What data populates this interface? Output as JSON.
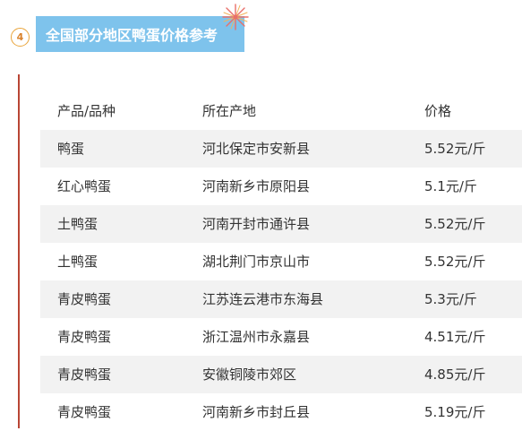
{
  "section": {
    "number": "4",
    "title": "全国部分地区鸭蛋价格参考"
  },
  "table": {
    "headers": [
      "产品/品种",
      "所在产地",
      "价格"
    ],
    "rows": [
      [
        "鸭蛋",
        "河北保定市安新县",
        "5.52元/斤"
      ],
      [
        "红心鸭蛋",
        "河南新乡市原阳县",
        "5.1元/斤"
      ],
      [
        "土鸭蛋",
        "河南开封市通许县",
        "5.52元/斤"
      ],
      [
        "土鸭蛋",
        "湖北荆门市京山市",
        "5.52元/斤"
      ],
      [
        "青皮鸭蛋",
        "江苏连云港市东海县",
        "5.3元/斤"
      ],
      [
        "青皮鸭蛋",
        "浙江温州市永嘉县",
        "4.51元/斤"
      ],
      [
        "青皮鸭蛋",
        "安徽铜陵市郊区",
        "4.85元/斤"
      ],
      [
        "青皮鸭蛋",
        "河南新乡市封丘县",
        "5.19元/斤"
      ]
    ]
  },
  "colors": {
    "banner": "#7ec3ec",
    "accent_line": "#b94535",
    "number_circle": "#e9a43a",
    "row_stripe": "#f2f2f2"
  }
}
